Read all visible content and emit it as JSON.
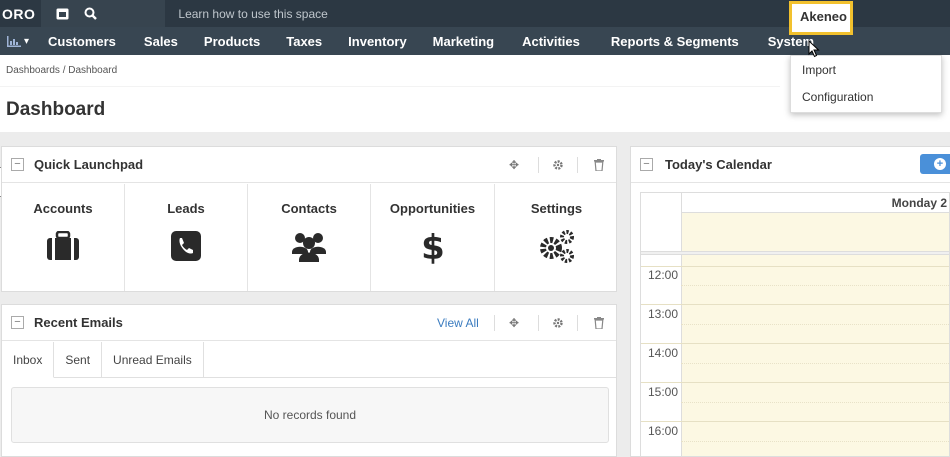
{
  "topbar": {
    "logo": "ORO",
    "learn_link": "Learn how to use this space",
    "icons": [
      "window-icon",
      "search-icon"
    ]
  },
  "menu": {
    "items": [
      "Customers",
      "Sales",
      "Products",
      "Taxes",
      "Inventory",
      "Marketing",
      "Activities",
      "Reports & Segments",
      "System"
    ],
    "highlighted": "Akeneo",
    "dropdown": [
      "Import",
      "Configuration"
    ]
  },
  "header": {
    "breadcrumb": "Dashboards / Dashboard",
    "title": "Dashboard"
  },
  "quick_launchpad": {
    "title": "Quick Launchpad",
    "items": [
      {
        "label": "Accounts",
        "icon": "briefcase-icon"
      },
      {
        "label": "Leads",
        "icon": "phone-icon"
      },
      {
        "label": "Contacts",
        "icon": "users-icon"
      },
      {
        "label": "Opportunities",
        "icon": "dollar-icon"
      },
      {
        "label": "Settings",
        "icon": "cogs-icon"
      }
    ]
  },
  "recent_emails": {
    "title": "Recent Emails",
    "view_all": "View All",
    "tabs": [
      "Inbox",
      "Sent",
      "Unread Emails"
    ],
    "empty": "No records found"
  },
  "calendar": {
    "title": "Today's Calendar",
    "day": "Monday 2",
    "hours": [
      "12:00",
      "13:00",
      "14:00",
      "15:00",
      "16:00"
    ]
  },
  "colors": {
    "topbar": "#2c3843",
    "menubar": "#384652",
    "highlight": "#f2c12e",
    "calendar_bg": "#fcf8e3",
    "accent": "#4a90d9"
  }
}
